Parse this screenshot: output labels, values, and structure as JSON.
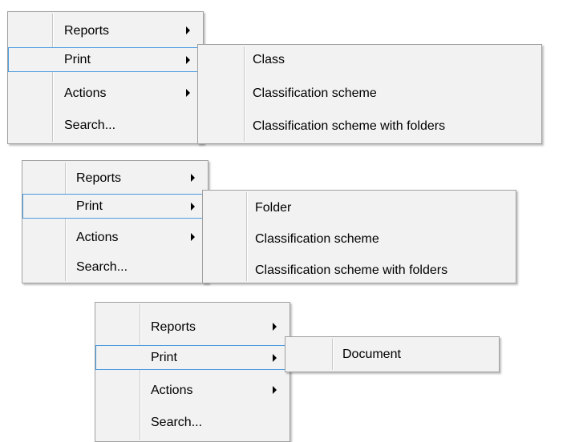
{
  "menus": [
    {
      "main": {
        "items": [
          {
            "label": "Reports",
            "has_submenu": true
          },
          {
            "label": "Print",
            "has_submenu": true,
            "highlighted": true
          },
          {
            "label": "Actions",
            "has_submenu": true
          },
          {
            "label": "Search...",
            "has_submenu": false
          }
        ]
      },
      "submenu": {
        "items": [
          {
            "label": "Class"
          },
          {
            "label": "Classification scheme"
          },
          {
            "label": "Classification scheme with folders"
          }
        ]
      }
    },
    {
      "main": {
        "items": [
          {
            "label": "Reports",
            "has_submenu": true
          },
          {
            "label": "Print",
            "has_submenu": true,
            "highlighted": true
          },
          {
            "label": "Actions",
            "has_submenu": true
          },
          {
            "label": "Search...",
            "has_submenu": false
          }
        ]
      },
      "submenu": {
        "items": [
          {
            "label": "Folder"
          },
          {
            "label": "Classification scheme"
          },
          {
            "label": "Classification scheme with folders"
          }
        ]
      }
    },
    {
      "main": {
        "items": [
          {
            "label": "Reports",
            "has_submenu": true
          },
          {
            "label": "Print",
            "has_submenu": true,
            "highlighted": true
          },
          {
            "label": "Actions",
            "has_submenu": true
          },
          {
            "label": "Search...",
            "has_submenu": false
          }
        ]
      },
      "submenu": {
        "items": [
          {
            "label": "Document"
          }
        ]
      }
    }
  ],
  "colors": {
    "menu_bg": "#f2f2f2",
    "menu_border": "#a0a0a0",
    "highlight_border": "#4a9be0"
  },
  "icons": {
    "submenu_arrow": "chevron-right-icon"
  }
}
